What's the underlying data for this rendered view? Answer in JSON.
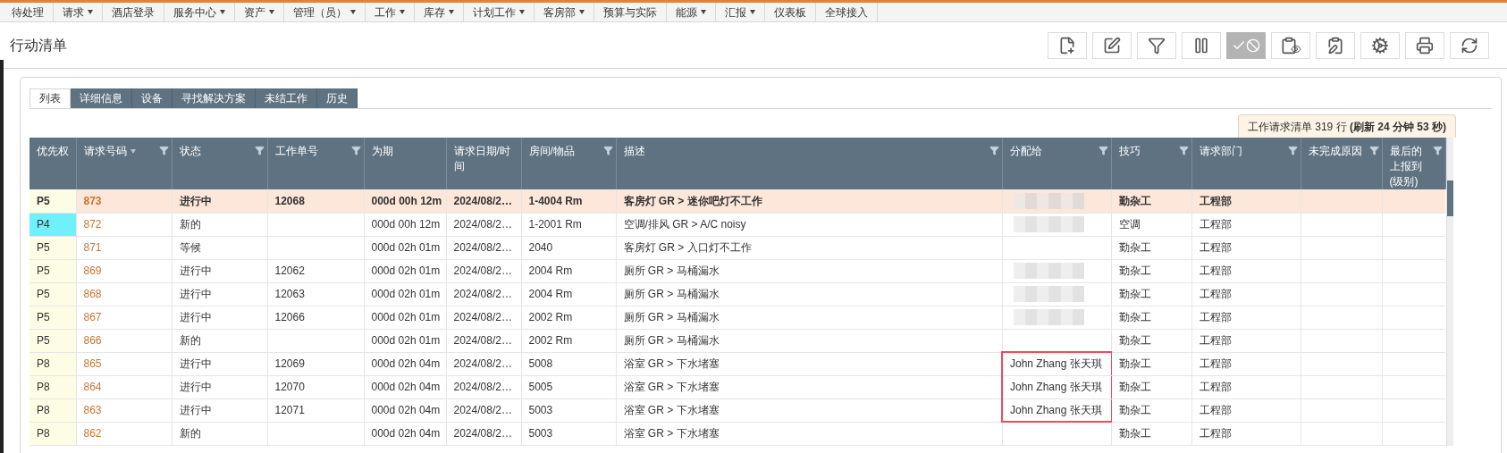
{
  "menu": [
    {
      "label": "待处理",
      "has_menu": false
    },
    {
      "label": "请求",
      "has_menu": true
    },
    {
      "label": "酒店登录",
      "has_menu": false
    },
    {
      "label": "服务中心",
      "has_menu": true
    },
    {
      "label": "资产",
      "has_menu": true
    },
    {
      "label": "管理（员）",
      "has_menu": true
    },
    {
      "label": "工作",
      "has_menu": true
    },
    {
      "label": "库存",
      "has_menu": true
    },
    {
      "label": "计划工作",
      "has_menu": true
    },
    {
      "label": "客房部",
      "has_menu": true
    },
    {
      "label": "预算与实际",
      "has_menu": false
    },
    {
      "label": "能源",
      "has_menu": true
    },
    {
      "label": "汇报",
      "has_menu": true
    },
    {
      "label": "仪表板",
      "has_menu": false
    },
    {
      "label": "全球接入",
      "has_menu": false
    }
  ],
  "page_title": "行动清单",
  "toolbar": [
    {
      "kind": "new",
      "disabled": false
    },
    {
      "kind": "edit",
      "disabled": false
    },
    {
      "kind": "filter",
      "disabled": false
    },
    {
      "kind": "pause",
      "disabled": false
    },
    {
      "kind": "complete",
      "disabled": true
    },
    {
      "kind": "view",
      "disabled": false
    },
    {
      "kind": "sign",
      "disabled": false
    },
    {
      "kind": "settings",
      "disabled": false
    },
    {
      "kind": "print",
      "disabled": false
    },
    {
      "kind": "refresh",
      "disabled": false
    }
  ],
  "tabs": [
    {
      "label": "列表",
      "selected": true
    },
    {
      "label": "详细信息",
      "selected": false
    },
    {
      "label": "设备",
      "selected": false
    },
    {
      "label": "寻找解决方案",
      "selected": false
    },
    {
      "label": "未结工作",
      "selected": false
    },
    {
      "label": "历史",
      "selected": false
    }
  ],
  "count_label": "工作请求清单 319 行 **(刷新 24 分钟 53 秒)**",
  "table": {
    "columns": [
      {
        "label": "优先权",
        "filter": false,
        "sorted": false
      },
      {
        "label": "请求号码",
        "filter": true,
        "sorted": true
      },
      {
        "label": "状态",
        "filter": true,
        "sorted": false
      },
      {
        "label": "工作单号",
        "filter": true,
        "sorted": false
      },
      {
        "label": "为期",
        "filter": false,
        "sorted": false
      },
      {
        "label": "请求日期/时间",
        "filter": false,
        "sorted": false
      },
      {
        "label": "房间/物品",
        "filter": true,
        "sorted": false
      },
      {
        "label": "描述",
        "filter": true,
        "sorted": false
      },
      {
        "label": "分配给",
        "filter": true,
        "sorted": false
      },
      {
        "label": "技巧",
        "filter": true,
        "sorted": false
      },
      {
        "label": "请求部门",
        "filter": true,
        "sorted": false
      },
      {
        "label": "未完成原因",
        "filter": true,
        "sorted": false
      },
      {
        "label": "最后的上报到(级别)",
        "filter": true,
        "sorted": false
      }
    ],
    "rows": [
      {
        "selected": true,
        "priority": "P5",
        "color": "#fdfde6",
        "request": "873",
        "status": "进行中",
        "work_order": "12068",
        "duration": "000d 00h 12m",
        "date": "2024/08/2…",
        "room": "1-4004 Rm",
        "description": "客房灯 GR > 迷你吧灯不工作",
        "assigned": "",
        "blurred": true,
        "highlighted": false,
        "skill": "勤杂工",
        "dept": "工程部"
      },
      {
        "selected": false,
        "priority": "P4",
        "color": "#6ff0fb",
        "request": "872",
        "status": "新的",
        "work_order": "",
        "duration": "000d 00h 12m",
        "date": "2024/08/2…",
        "room": "1-2001 Rm",
        "description": "空调/排风 GR > A/C noisy",
        "assigned": "",
        "blurred": true,
        "highlighted": false,
        "skill": "空调",
        "dept": "工程部"
      },
      {
        "selected": false,
        "priority": "P5",
        "color": "#fdfde6",
        "request": "871",
        "status": "等候",
        "work_order": "",
        "duration": "000d 02h 01m",
        "date": "2024/08/2…",
        "room": "2040",
        "description": "客房灯 GR > 入口灯不工作",
        "assigned": "",
        "blurred": false,
        "highlighted": false,
        "skill": "勤杂工",
        "dept": "工程部"
      },
      {
        "selected": false,
        "priority": "P5",
        "color": "#fdfde6",
        "request": "869",
        "status": "进行中",
        "work_order": "12062",
        "duration": "000d 02h 01m",
        "date": "2024/08/2…",
        "room": "2004 Rm",
        "description": "厕所 GR > 马桶漏水",
        "assigned": "",
        "blurred": true,
        "highlighted": false,
        "skill": "勤杂工",
        "dept": "工程部"
      },
      {
        "selected": false,
        "priority": "P5",
        "color": "#fdfde6",
        "request": "868",
        "status": "进行中",
        "work_order": "12063",
        "duration": "000d 02h 01m",
        "date": "2024/08/2…",
        "room": "2004 Rm",
        "description": "厕所 GR > 马桶漏水",
        "assigned": "",
        "blurred": true,
        "highlighted": false,
        "skill": "勤杂工",
        "dept": "工程部"
      },
      {
        "selected": false,
        "priority": "P5",
        "color": "#fdfde6",
        "request": "867",
        "status": "进行中",
        "work_order": "12066",
        "duration": "000d 02h 01m",
        "date": "2024/08/2…",
        "room": "2002 Rm",
        "description": "厕所 GR > 马桶漏水",
        "assigned": "",
        "blurred": true,
        "highlighted": false,
        "skill": "勤杂工",
        "dept": "工程部"
      },
      {
        "selected": false,
        "priority": "P5",
        "color": "#fdfde6",
        "request": "866",
        "status": "新的",
        "work_order": "",
        "duration": "000d 02h 01m",
        "date": "2024/08/2…",
        "room": "2002 Rm",
        "description": "厕所 GR > 马桶漏水",
        "assigned": "",
        "blurred": false,
        "highlighted": false,
        "skill": "勤杂工",
        "dept": "工程部"
      },
      {
        "selected": false,
        "priority": "P8",
        "color": "#fdfde6",
        "request": "865",
        "status": "进行中",
        "work_order": "12069",
        "duration": "000d 02h 04m",
        "date": "2024/08/2…",
        "room": "5008",
        "description": "浴室 GR > 下水堵塞",
        "assigned": "John Zhang 张天琪",
        "blurred": false,
        "highlighted": true,
        "skill": "勤杂工",
        "dept": "工程部"
      },
      {
        "selected": false,
        "priority": "P8",
        "color": "#fdfde6",
        "request": "864",
        "status": "进行中",
        "work_order": "12070",
        "duration": "000d 02h 04m",
        "date": "2024/08/2…",
        "room": "5005",
        "description": "浴室 GR > 下水堵塞",
        "assigned": "John Zhang 张天琪",
        "blurred": false,
        "highlighted": true,
        "skill": "勤杂工",
        "dept": "工程部"
      },
      {
        "selected": false,
        "priority": "P8",
        "color": "#fdfde6",
        "request": "863",
        "status": "进行中",
        "work_order": "12071",
        "duration": "000d 02h 04m",
        "date": "2024/08/2…",
        "room": "5003",
        "description": "浴室 GR > 下水堵塞",
        "assigned": "John Zhang 张天琪",
        "blurred": false,
        "highlighted": true,
        "skill": "勤杂工",
        "dept": "工程部"
      },
      {
        "selected": false,
        "priority": "P8",
        "color": "#fdfde6",
        "request": "862",
        "status": "新的",
        "work_order": "",
        "duration": "000d 02h 04m",
        "date": "2024/08/2…",
        "room": "5003",
        "description": "浴室 GR > 下水堵塞",
        "assigned": "",
        "blurred": false,
        "highlighted": false,
        "skill": "勤杂工",
        "dept": "工程部"
      }
    ]
  }
}
